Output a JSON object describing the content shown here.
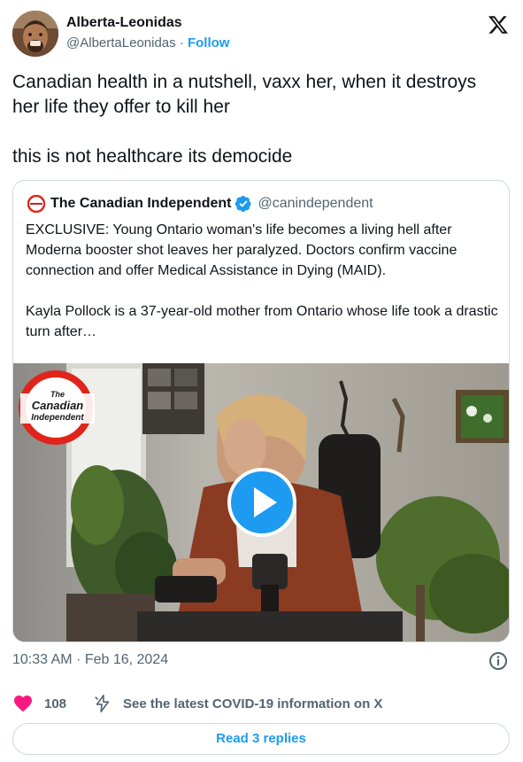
{
  "author": {
    "display_name": "Alberta-Leonidas",
    "handle": "@AlbertaLeonidas",
    "separator": "·",
    "follow_label": "Follow"
  },
  "tweet": {
    "text": "Canadian health in a nutshell, vaxx her, when it destroys her life they offer to kill her\n\nthis is not healthcare its democide"
  },
  "quote": {
    "name": "The Canadian Independent",
    "handle": "@canindependent",
    "text": "EXCLUSIVE: Young Ontario woman's life becomes a living hell after Moderna booster shot leaves her paralyzed. Doctors confirm vaccine connection and offer Medical Assistance in Dying (MAID).\n\nKayla Pollock is a 37-year-old mother from Ontario whose life took a drastic turn after…",
    "video": {
      "logo_lines": [
        "The",
        "Canadian",
        "Independent"
      ]
    }
  },
  "meta": {
    "timestamp": "10:33 AM · Feb 16, 2024"
  },
  "actions": {
    "like_count": "108",
    "covid_link": "See the latest COVID-19 information on X",
    "replies_button": "Read 3 replies"
  },
  "colors": {
    "accent": "#1d9bf0",
    "heart": "#f91880",
    "text_secondary": "#536471",
    "border": "#cfd9de"
  }
}
